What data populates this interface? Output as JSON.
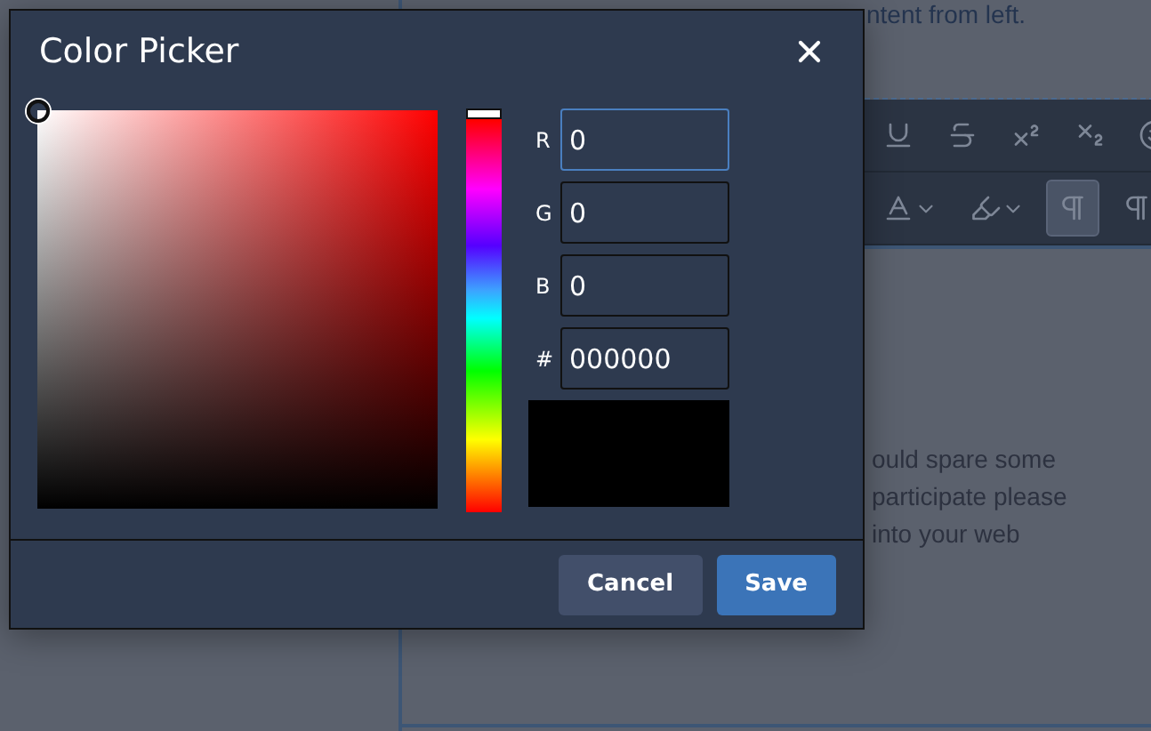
{
  "editor": {
    "top_text": "ntent from left.",
    "toolbar_rows": [
      [
        {
          "kind": "underline",
          "selected": false
        },
        {
          "kind": "strike",
          "selected": false
        },
        {
          "kind": "superscript",
          "selected": false
        },
        {
          "kind": "subscript",
          "selected": false
        },
        {
          "kind": "emoji",
          "selected": false
        }
      ],
      [
        {
          "kind": "text-color",
          "selected": false
        },
        {
          "kind": "highlight",
          "selected": false
        },
        {
          "kind": "ltr",
          "selected": true
        },
        {
          "kind": "rtl",
          "selected": false
        }
      ]
    ],
    "body_lines": [
      "ould spare some",
      "participate please",
      "into your web"
    ]
  },
  "dialog": {
    "title": "Color Picker",
    "hue": {
      "level": 0
    },
    "fields": [
      {
        "label": "R",
        "value": "0",
        "focused": true
      },
      {
        "label": "G",
        "value": "0",
        "focused": false
      },
      {
        "label": "B",
        "value": "0",
        "focused": false
      },
      {
        "label": "#",
        "value": "000000",
        "focused": false
      }
    ],
    "buttons": [
      {
        "label": "Cancel",
        "kind": "secondary"
      },
      {
        "label": "Save",
        "kind": "primary"
      }
    ]
  }
}
